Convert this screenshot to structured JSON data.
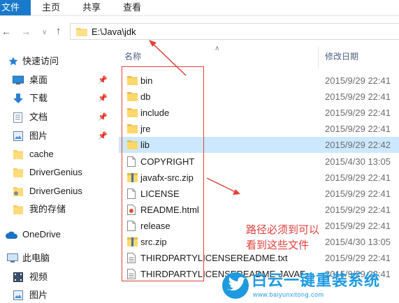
{
  "ribbon": {
    "file": "文件",
    "home": "主页",
    "share": "共享",
    "view": "查看"
  },
  "address": {
    "path": "E:\\Java\\jdk"
  },
  "sidebar": {
    "items": [
      {
        "label": "快速访问",
        "icon": "star-icon",
        "pinned": false
      },
      {
        "label": "桌面",
        "icon": "desktop-icon",
        "pinned": true
      },
      {
        "label": "下载",
        "icon": "download-icon",
        "pinned": true
      },
      {
        "label": "文档",
        "icon": "document-icon",
        "pinned": true
      },
      {
        "label": "图片",
        "icon": "pictures-icon",
        "pinned": true
      },
      {
        "label": "cache",
        "icon": "folder-icon",
        "pinned": false
      },
      {
        "label": "DriverGenius",
        "icon": "folder-icon",
        "pinned": false
      },
      {
        "label": "DriverGenius",
        "icon": "drivergenius-icon",
        "pinned": false
      },
      {
        "label": "我的存储",
        "icon": "folder-icon",
        "pinned": false
      },
      {
        "label": "OneDrive",
        "icon": "cloud-icon",
        "pinned": false
      },
      {
        "label": "此电脑",
        "icon": "computer-icon",
        "pinned": false
      },
      {
        "label": "视频",
        "icon": "video-icon",
        "pinned": false
      },
      {
        "label": "图片",
        "icon": "pictures-icon",
        "pinned": false
      }
    ]
  },
  "columns": {
    "name": "名称",
    "date": "修改日期"
  },
  "files": [
    {
      "name": "bin",
      "date": "2015/9/29 22:41",
      "icon": "folder-icon"
    },
    {
      "name": "db",
      "date": "2015/9/29 22:41",
      "icon": "folder-icon"
    },
    {
      "name": "include",
      "date": "2015/9/29 22:41",
      "icon": "folder-icon"
    },
    {
      "name": "jre",
      "date": "2015/9/29 22:41",
      "icon": "folder-icon"
    },
    {
      "name": "lib",
      "date": "2015/9/29 22:42",
      "icon": "folder-icon"
    },
    {
      "name": "COPYRIGHT",
      "date": "2015/4/30 13:05",
      "icon": "file-icon"
    },
    {
      "name": "javafx-src.zip",
      "date": "2015/9/29 22:41",
      "icon": "zip-icon"
    },
    {
      "name": "LICENSE",
      "date": "2015/9/29 22:41",
      "icon": "file-icon"
    },
    {
      "name": "README.html",
      "date": "2015/9/29 22:41",
      "icon": "html-icon"
    },
    {
      "name": "release",
      "date": "2015/9/29 22:41",
      "icon": "file-icon"
    },
    {
      "name": "src.zip",
      "date": "2015/4/30 13:05",
      "icon": "zip-icon"
    },
    {
      "name": "THIRDPARTYLICENSEREADME.txt",
      "date": "2015/9/29 22:41",
      "icon": "text-icon"
    },
    {
      "name": "THIRDPARTYLICENSEREADME-JAVAF...",
      "date": "2015/9/29 22:41",
      "icon": "text-icon"
    }
  ],
  "annotation": {
    "line1": "路径必须到可以",
    "line2": "看到这些文件"
  },
  "watermark": {
    "title": "白云一键重装系统",
    "url": "www.baiyunxitong.com"
  },
  "colors": {
    "accent": "#1979ca",
    "selection": "#cce8ff",
    "annotation": "#e0403a",
    "watermark": "#1e9ae0"
  }
}
